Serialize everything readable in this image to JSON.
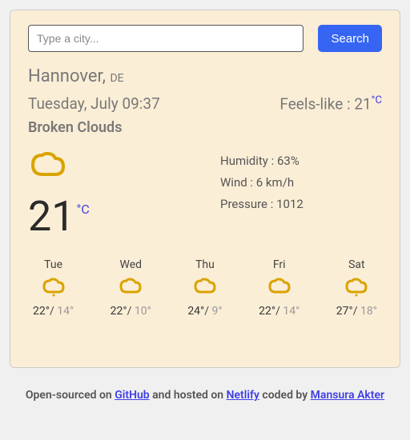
{
  "search": {
    "placeholder": "Type a city...",
    "button": "Search"
  },
  "location": {
    "city": "Hannover",
    "country": "DE"
  },
  "datetime": "Tuesday, July 09:37",
  "feelsLike": {
    "label": "Feels-like : ",
    "value": "21",
    "unit": "°C"
  },
  "description": "Broken Clouds",
  "current": {
    "temp": "21",
    "unit": "°C"
  },
  "stats": {
    "humidity": {
      "label": "Humidity : ",
      "value": "63%"
    },
    "wind": {
      "label": "Wind : ",
      "value": "6 km/h"
    },
    "pressure": {
      "label": "Pressure : ",
      "value": "1012"
    }
  },
  "forecast": [
    {
      "day": "Tue",
      "hi": "22°",
      "lo": "14°"
    },
    {
      "day": "Wed",
      "hi": "22°",
      "lo": "10°"
    },
    {
      "day": "Thu",
      "hi": "24°",
      "lo": "9°"
    },
    {
      "day": "Fri",
      "hi": "22°",
      "lo": "14°"
    },
    {
      "day": "Sat",
      "hi": "27°",
      "lo": "18°"
    }
  ],
  "footer": {
    "t1": "Open-sourced on ",
    "github": "GitHub",
    "t2": " and hosted on ",
    "netlify": "Netlify",
    "t3": " coded by ",
    "author": "Mansura Akter"
  }
}
